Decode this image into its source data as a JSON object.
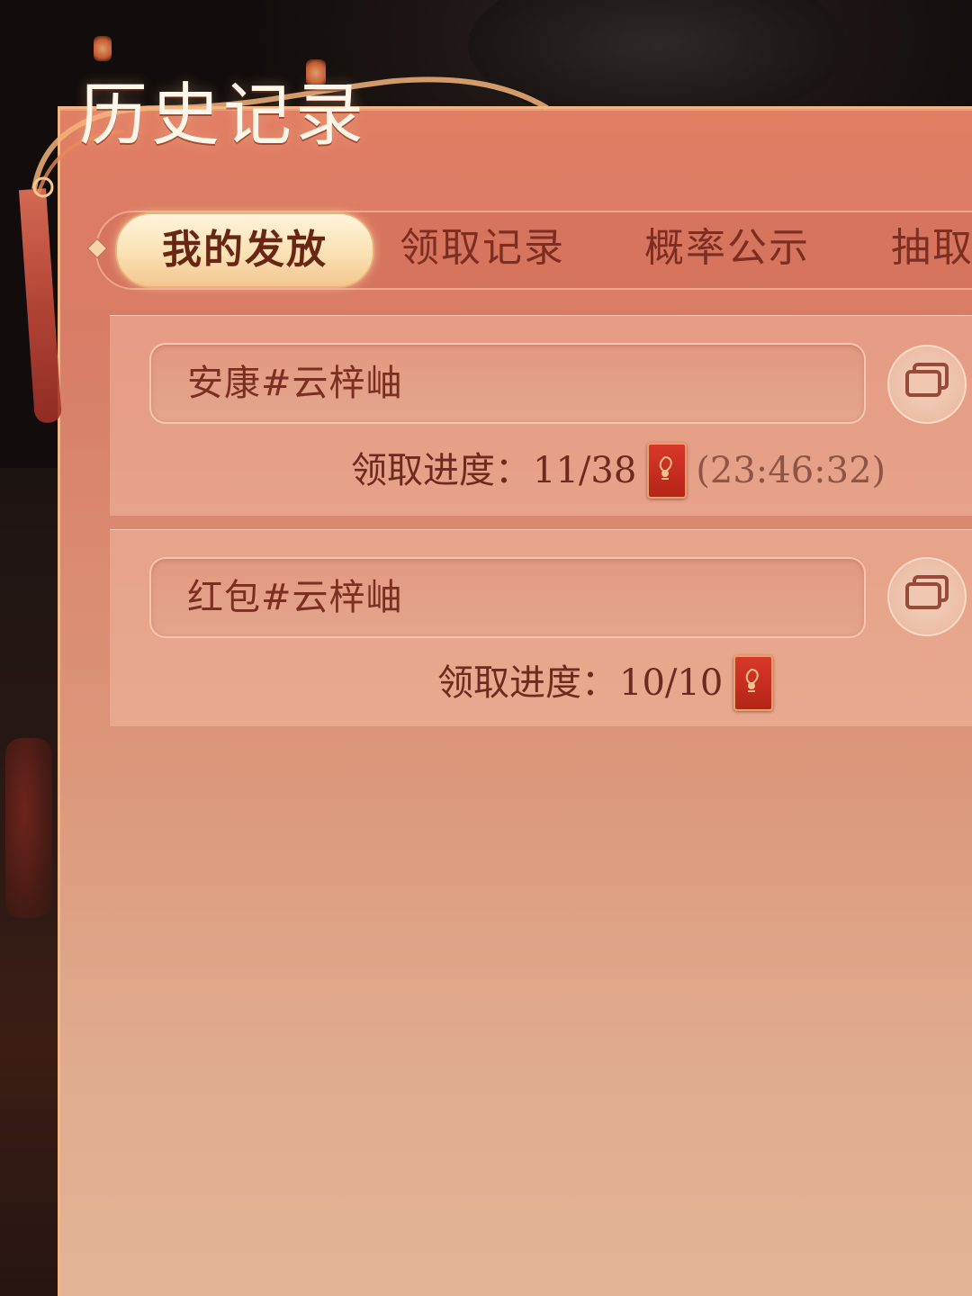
{
  "header": {
    "title": "历史记录"
  },
  "tabs": [
    {
      "label": "我的发放",
      "active": true
    },
    {
      "label": "领取记录",
      "active": false
    },
    {
      "label": "概率公示",
      "active": false
    },
    {
      "label": "抽取",
      "active": false
    }
  ],
  "records": [
    {
      "name": "安康#云梓岫",
      "progress_label": "领取进度：",
      "progress_value": "11/38",
      "timer": "(23:46:32)",
      "icon": "red-envelope-icon"
    },
    {
      "name": "红包#云梓岫",
      "progress_label": "领取进度：",
      "progress_value": "10/10",
      "icon": "red-envelope-icon"
    }
  ],
  "colors": {
    "panel_top": "#d8705e",
    "panel_bottom": "#e2b596",
    "active_tab": "#fbe1b4",
    "text_dark_red": "#7a2f22"
  }
}
